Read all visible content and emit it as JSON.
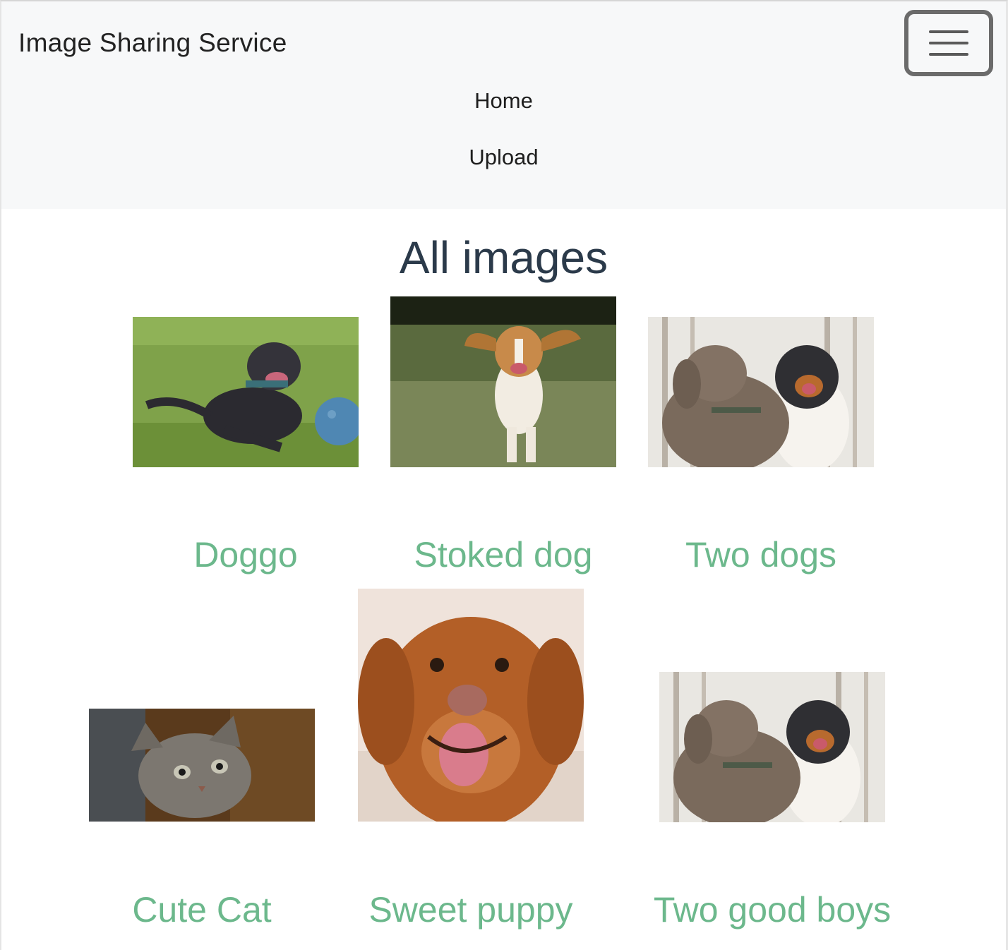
{
  "navbar": {
    "brand": "Image Sharing Service",
    "toggle_icon": "hamburger-menu-icon",
    "links": [
      "Home",
      "Upload"
    ]
  },
  "main": {
    "title": "All images",
    "images": [
      {
        "caption": "Doggo"
      },
      {
        "caption": "Stoked dog"
      },
      {
        "caption": "Two dogs"
      },
      {
        "caption": "Cute Cat"
      },
      {
        "caption": "Sweet puppy"
      },
      {
        "caption": "Two good boys"
      }
    ]
  },
  "colors": {
    "navbar_bg": "#f7f8f9",
    "title": "#2b3a4a",
    "caption": "#6cb88c",
    "toggler_border": "#6b6b6b"
  }
}
